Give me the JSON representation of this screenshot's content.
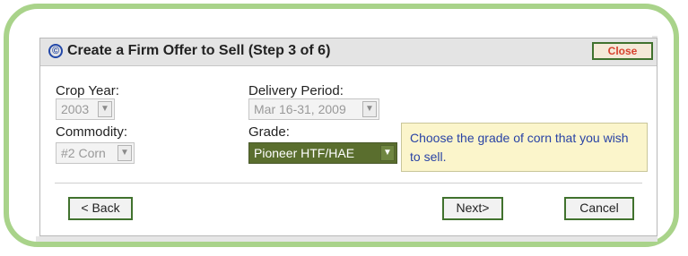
{
  "dialog": {
    "title": "Create a Firm Offer to Sell (Step 3 of 6)",
    "copyright_glyph": "©",
    "close_label": "Close"
  },
  "fields": {
    "crop_year": {
      "label": "Crop Year:",
      "value": "2003"
    },
    "delivery_period": {
      "label": "Delivery Period:",
      "value": "Mar 16-31, 2009"
    },
    "commodity": {
      "label": "Commodity:",
      "value": "#2 Corn"
    },
    "grade": {
      "label": "Grade:",
      "value": "Pioneer HTF/HAE"
    }
  },
  "tooltip": {
    "text": "Choose the grade of corn that you wish to sell."
  },
  "buttons": {
    "back": "< Back",
    "next": "Next>",
    "cancel": "Cancel"
  },
  "colors": {
    "frame_green": "#a9d38a",
    "button_border": "#41722e",
    "tooltip_bg": "#fbf5cb",
    "tooltip_text": "#2943a5",
    "close_text": "#d7422e"
  }
}
